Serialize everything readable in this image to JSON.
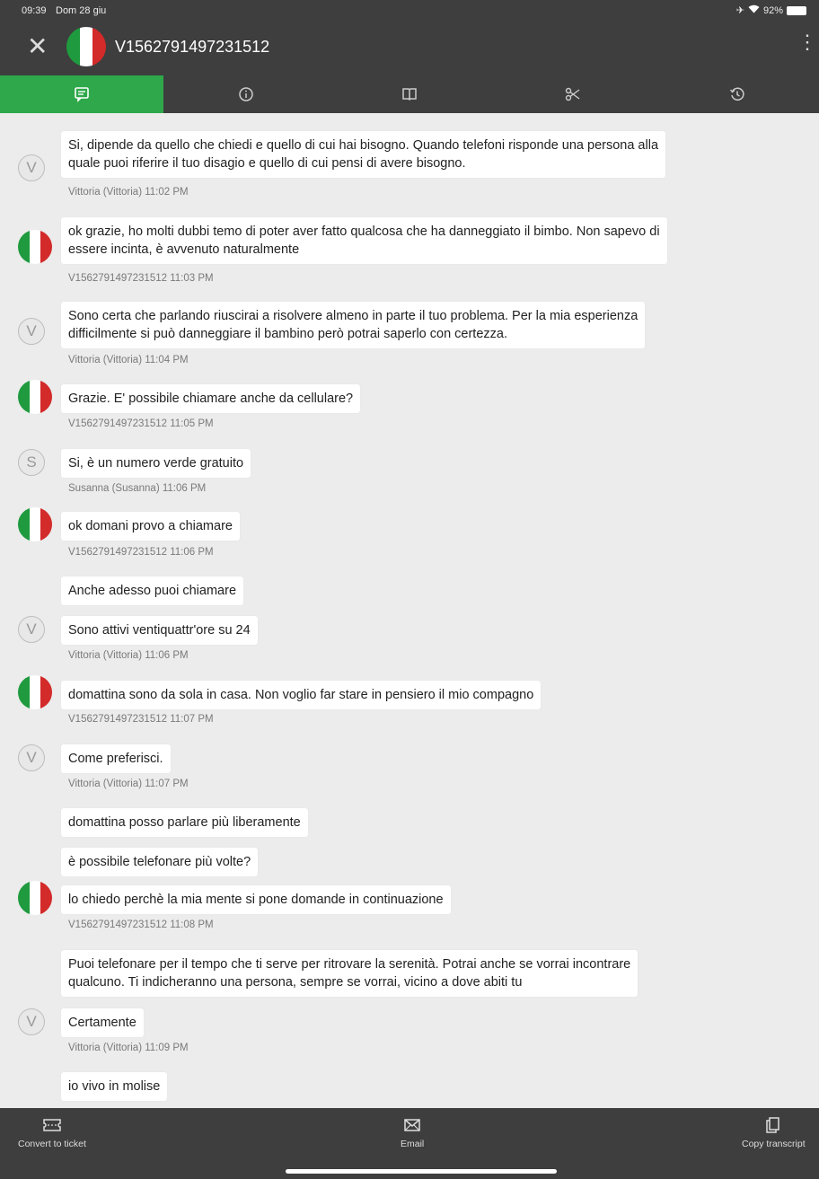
{
  "status": {
    "time": "09:39",
    "date": "Dom 28 giu",
    "battery": "92%"
  },
  "header": {
    "title": "V1562791497231512"
  },
  "tabs": [
    {
      "icon": "chat-icon",
      "active": true
    },
    {
      "icon": "info-icon",
      "active": false
    },
    {
      "icon": "book-icon",
      "active": false
    },
    {
      "icon": "scissors-icon",
      "active": false
    },
    {
      "icon": "history-icon",
      "active": false
    }
  ],
  "messages": {
    "m1": {
      "text1": "Si, dipende da quello che chiedi e quello di cui hai bisogno. Quando telefoni risponde una persona alla",
      "text2": "quale puoi riferire il tuo disagio e quello di cui pensi di avere bisogno.",
      "avatar": "V",
      "meta": "Vittoria (Vittoria) 11:02 PM"
    },
    "m2": {
      "text1": "ok grazie, ho molti dubbi temo di poter aver fatto qualcosa che ha danneggiato il bimbo. Non sapevo di",
      "text2": "essere incinta, è avvenuto naturalmente",
      "meta": "V1562791497231512 11:03 PM"
    },
    "m3": {
      "text1": "Sono certa che parlando riuscirai a risolvere almeno in parte il tuo problema. Per la mia esperienza",
      "text2": "difficilmente si può danneggiare il bambino però potrai saperlo con certezza.",
      "avatar": "V",
      "meta": "Vittoria (Vittoria) 11:04 PM"
    },
    "m4": {
      "text": "Grazie. E' possibile chiamare anche da cellulare?",
      "meta": "V1562791497231512 11:05 PM"
    },
    "m5": {
      "text": "Si, è un numero verde gratuito",
      "avatar": "S",
      "meta": "Susanna (Susanna) 11:06 PM"
    },
    "m6": {
      "text": "ok domani provo a chiamare",
      "meta": "V1562791497231512 11:06 PM"
    },
    "m7": {
      "text": "Anche adesso puoi chiamare"
    },
    "m8": {
      "text": "Sono attivi ventiquattr'ore su 24",
      "avatar": "V",
      "meta": "Vittoria (Vittoria) 11:06 PM"
    },
    "m9": {
      "text": "domattina sono da sola in casa. Non voglio far stare in pensiero il mio compagno",
      "meta": "V1562791497231512 11:07 PM"
    },
    "m10": {
      "text": "Come preferisci.",
      "avatar": "V",
      "meta": "Vittoria (Vittoria) 11:07 PM"
    },
    "m11": {
      "text": "domattina posso parlare più liberamente"
    },
    "m12": {
      "text": "è possibile telefonare più volte?"
    },
    "m13": {
      "text": "lo chiedo perchè la mia mente si pone domande in continuazione",
      "meta": "V1562791497231512 11:08 PM"
    },
    "m14": {
      "text1": "Puoi telefonare per il tempo che ti serve per ritrovare la serenità. Potrai anche se vorrai incontrare",
      "text2": "qualcuno. Ti indicheranno una persona, sempre se vorrai, vicino a dove abiti tu"
    },
    "m15": {
      "text": "Certamente",
      "avatar": "V",
      "meta": "Vittoria (Vittoria) 11:09 PM"
    },
    "m16": {
      "text": "io vivo in molise"
    }
  },
  "bottom": {
    "convert_label": "Convert to ticket",
    "email_label": "Email",
    "copy_label": "Copy transcript"
  },
  "colors": {
    "accent": "#2ea84a",
    "bar": "#3e3e3e",
    "background": "#ececec"
  }
}
